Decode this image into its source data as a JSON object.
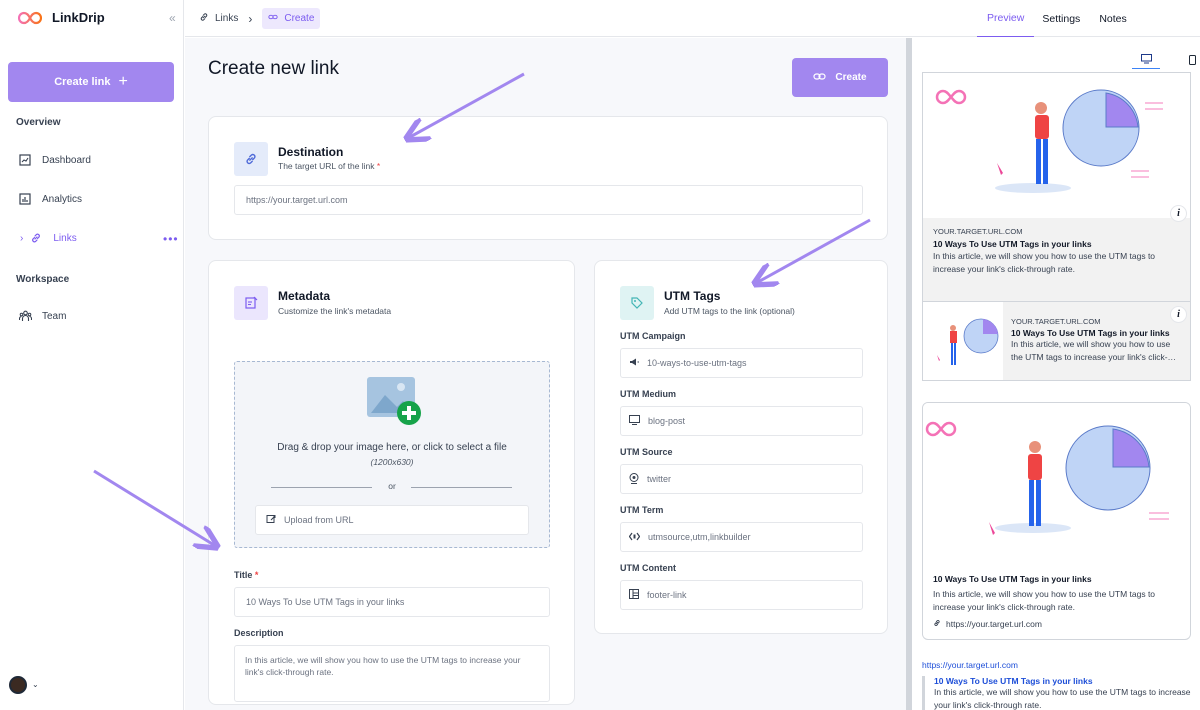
{
  "app": {
    "name": "LinkDrip"
  },
  "sidebar": {
    "create_label": "Create link",
    "overview_label": "Overview",
    "items": [
      {
        "label": "Dashboard",
        "icon": "dashboard-icon"
      },
      {
        "label": "Analytics",
        "icon": "analytics-icon"
      },
      {
        "label": "Links",
        "icon": "link-icon"
      }
    ],
    "workspace_label": "Workspace",
    "workspace_items": [
      {
        "label": "Team",
        "icon": "team-icon"
      }
    ]
  },
  "breadcrumb": {
    "root": "Links",
    "current": "Create"
  },
  "topTabs": [
    "Preview",
    "Settings",
    "Notes"
  ],
  "page": {
    "title": "Create new link",
    "create_button": "Create"
  },
  "destination": {
    "title": "Destination",
    "subtitle": "The target URL of the link",
    "placeholder": "https://your.target.url.com"
  },
  "metadata": {
    "title": "Metadata",
    "subtitle": "Customize the link's metadata",
    "drop_text": "Drag & drop your image here, or click to select a file",
    "size": "(1200x630)",
    "or": "or",
    "upload_url": "Upload from URL",
    "title_label": "Title",
    "title_value": "10 Ways To Use UTM Tags in your links",
    "description_label": "Description",
    "description_value": "In this article, we will show you how to use the UTM tags to increase your link's click-through rate."
  },
  "utm": {
    "title": "UTM Tags",
    "subtitle": "Add UTM tags to the link (optional)",
    "fields": [
      {
        "label": "UTM Campaign",
        "value": "10-ways-to-use-utm-tags",
        "icon": "megaphone-icon"
      },
      {
        "label": "UTM Medium",
        "value": "blog-post",
        "icon": "monitor-icon"
      },
      {
        "label": "UTM Source",
        "value": "twitter",
        "icon": "webcam-icon"
      },
      {
        "label": "UTM Term",
        "value": "utmsource,utm,linkbuilder",
        "icon": "code-icon"
      },
      {
        "label": "UTM Content",
        "value": "footer-link",
        "icon": "layout-icon"
      }
    ]
  },
  "preview": {
    "domain": "YOUR.TARGET.URL.COM",
    "title": "10 Ways To Use UTM Tags in your links",
    "desc": "In this article, we will show you how to use the UTM tags to increase your link's click-through rate.",
    "desc_short": "In this article, we will show you how to use the UTM tags to increase your link's click-…",
    "url": "https://your.target.url.com",
    "info": "i"
  },
  "colors": {
    "accent": "#a287ef",
    "accent_text": "#7c5cf0",
    "arrow": "#a287ef"
  }
}
